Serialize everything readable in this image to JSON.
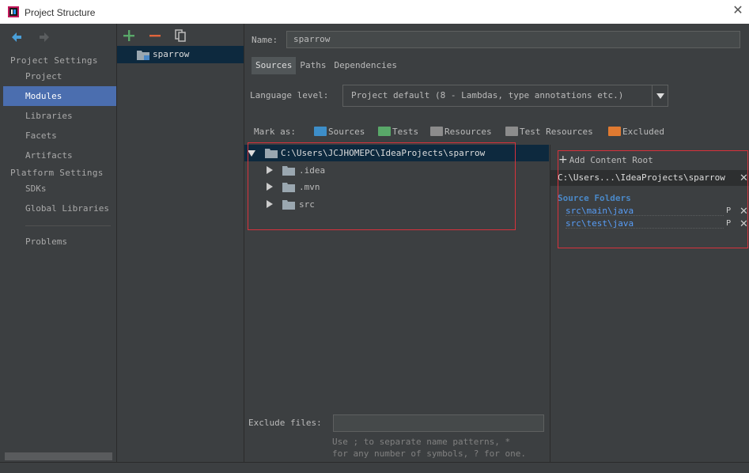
{
  "window": {
    "title": "Project Structure"
  },
  "sidebar": {
    "project_settings_header": "Project Settings",
    "platform_settings_header": "Platform Settings",
    "items": {
      "project": "Project",
      "modules": "Modules",
      "libraries": "Libraries",
      "facets": "Facets",
      "artifacts": "Artifacts",
      "sdks": "SDKs",
      "global_libraries": "Global Libraries",
      "problems": "Problems"
    },
    "selected": "Modules"
  },
  "modules": {
    "items": [
      "sparrow"
    ]
  },
  "module": {
    "name_label": "Name:",
    "name_value": "sparrow",
    "tabs": [
      "Sources",
      "Paths",
      "Dependencies"
    ],
    "active_tab": "Sources",
    "language_level_label": "Language level:",
    "language_level_value": "Project default (8 - Lambdas, type annotations etc.)",
    "mark_as_label": "Mark as:",
    "mark_as": [
      {
        "label": "Sources",
        "color": "#3d8ec9"
      },
      {
        "label": "Tests",
        "color": "#59a869"
      },
      {
        "label": "Resources",
        "color": "#8c8c8c"
      },
      {
        "label": "Test Resources",
        "color": "#8c8c8c"
      },
      {
        "label": "Excluded",
        "color": "#e07a31"
      }
    ],
    "tree": {
      "root": "C:\\Users\\JCJHOMEPC\\IdeaProjects\\sparrow",
      "children": [
        ".idea",
        ".mvn",
        "src"
      ]
    },
    "exclude_files_label": "Exclude files:",
    "exclude_files_value": "",
    "exclude_hint_line1": "Use ; to separate name patterns, *",
    "exclude_hint_line2": "for any number of symbols, ? for one.",
    "content_roots": {
      "add_label": "Add Content Root",
      "path": "C:\\Users...\\IdeaProjects\\sparrow",
      "source_folders_header": "Source Folders",
      "source_folders": [
        "src\\main\\java",
        "src\\test\\java"
      ]
    }
  },
  "colors": {
    "selection_blue": "#4b6eaf",
    "tree_selection": "#0d293e",
    "highlight_box": "#d8323c",
    "folder_gray": "#9aa7b0"
  }
}
